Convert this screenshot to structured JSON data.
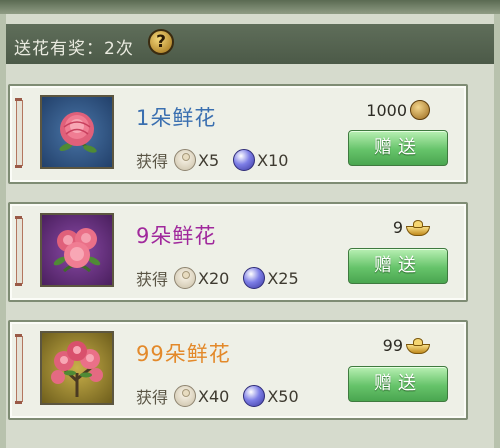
{
  "header": {
    "text": "送花有奖：2次",
    "help_icon": "question-mark-icon"
  },
  "cards": [
    {
      "title": "1朵鲜花",
      "title_color": "#3a6fb0",
      "gain_label": "获得",
      "reward1": "X5",
      "reward2": "X10",
      "price": "1000",
      "price_icon": "coin-icon",
      "button": "赠送",
      "thumb_bg": "#2f4f7a"
    },
    {
      "title": "9朵鲜花",
      "title_color": "#a0289c",
      "gain_label": "获得",
      "reward1": "X20",
      "reward2": "X25",
      "price": "9",
      "price_icon": "gold-ingot-icon",
      "button": "赠送",
      "thumb_bg": "#5a2a6e"
    },
    {
      "title": "99朵鲜花",
      "title_color": "#e3892a",
      "gain_label": "获得",
      "reward1": "X40",
      "reward2": "X50",
      "price": "99",
      "price_icon": "gold-ingot-icon",
      "button": "赠送",
      "thumb_bg": "#8a7a2a"
    }
  ]
}
